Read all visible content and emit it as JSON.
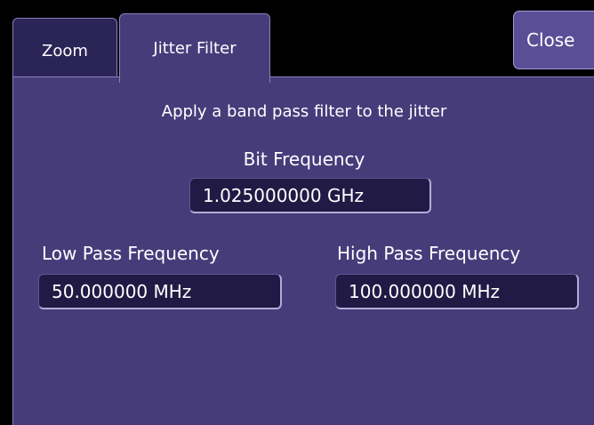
{
  "tabs": [
    {
      "label": "Zoom",
      "active": false
    },
    {
      "label": "Jitter Filter",
      "active": true
    }
  ],
  "close_button": {
    "label": "Close"
  },
  "panel": {
    "description": "Apply a band pass filter to the jitter",
    "bit_frequency": {
      "label": "Bit Frequency",
      "value": "1.025000000 GHz"
    },
    "low_pass": {
      "label": "Low Pass Frequency",
      "value": "50.000000 MHz"
    },
    "high_pass": {
      "label": "High Pass Frequency",
      "value": "100.000000 MHz"
    }
  },
  "colors": {
    "background": "#000000",
    "panel": "#463c7a",
    "inactive_tab": "#2b2456",
    "field": "#211a45",
    "close_button": "#5a4e96",
    "text": "#ffffff"
  }
}
